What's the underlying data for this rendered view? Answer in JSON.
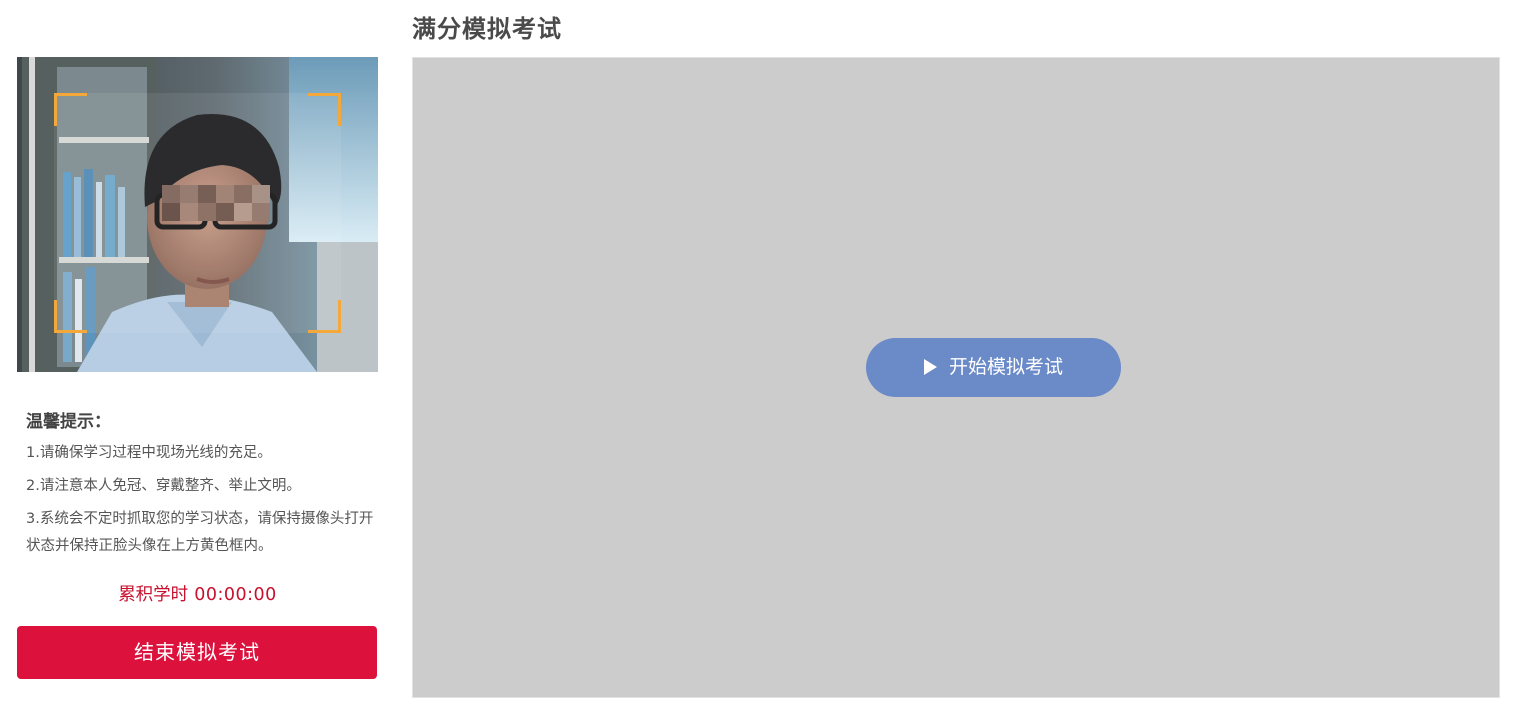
{
  "header": {
    "title": "满分模拟考试"
  },
  "camera": {
    "frame_color": "#f5a83a"
  },
  "tips": {
    "title": "温馨提示：",
    "items": [
      "1.请确保学习过程中现场光线的充足。",
      "2.请注意本人免冠、穿戴整齐、举止文明。",
      "3.系统会不定时抓取您的学习状态，请保持摄像头打开状态并保持正脸头像在上方黄色框内。"
    ]
  },
  "timer": {
    "label": "累积学时",
    "value": "00:00:00",
    "color": "#c8102e"
  },
  "actions": {
    "end_label": "结束模拟考试",
    "end_color": "#dc113c",
    "start_label": "开始模拟考试",
    "start_color": "#6a8ac8"
  },
  "icons": {
    "start": "play-icon"
  }
}
